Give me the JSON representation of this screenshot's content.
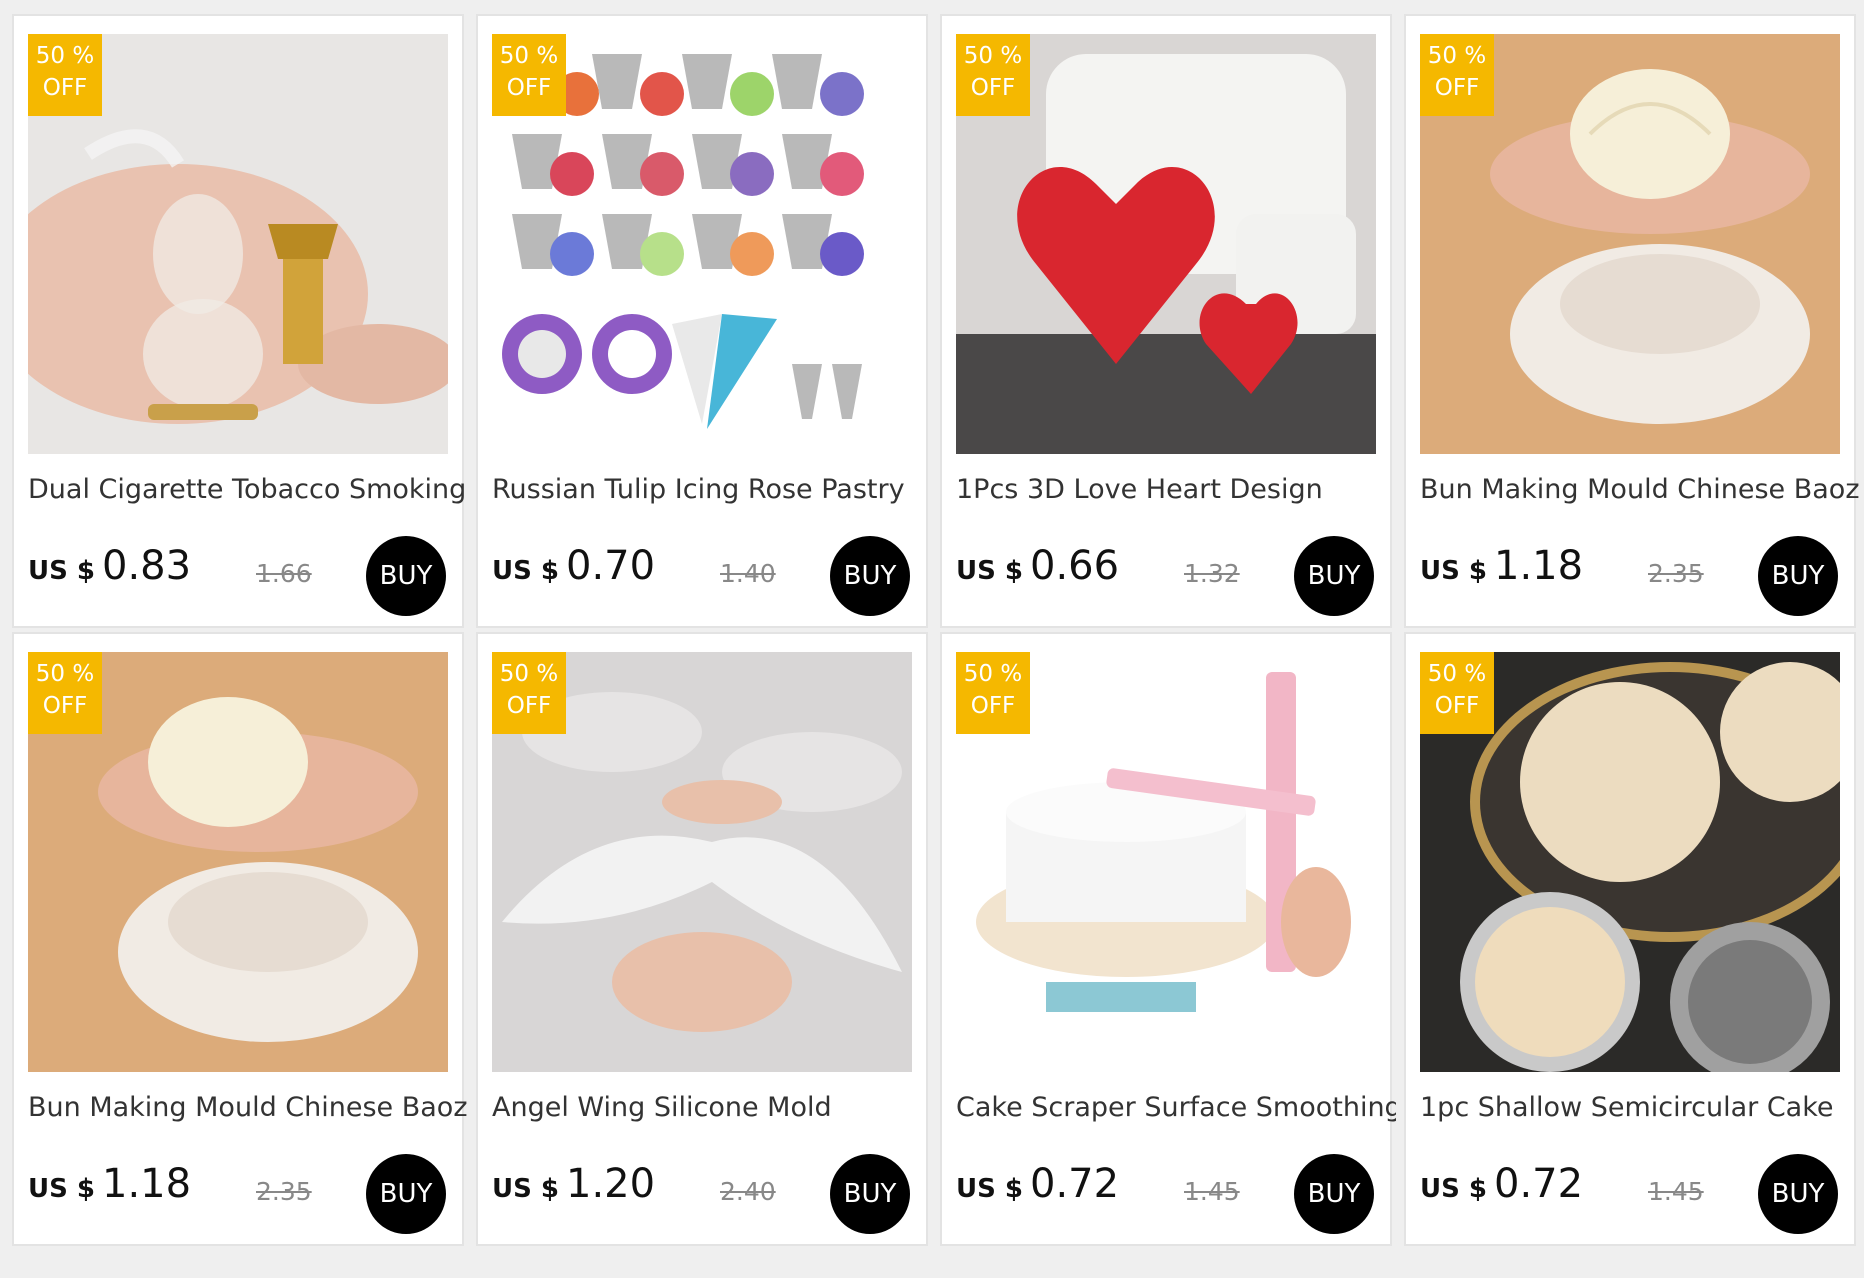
{
  "currency": "US $",
  "buy_label": "BUY",
  "badge": {
    "line1": "50 %",
    "line2": "OFF"
  },
  "products": [
    {
      "title": "Dual Cigarette Tobacco Smoking",
      "price": "0.83",
      "original_price": "1.66"
    },
    {
      "title": "Russian Tulip Icing Rose Pastry",
      "price": "0.70",
      "original_price": "1.40"
    },
    {
      "title": "1Pcs 3D Love Heart Design",
      "price": "0.66",
      "original_price": "1.32"
    },
    {
      "title": "Bun Making Mould Chinese Baozi",
      "price": "1.18",
      "original_price": "2.35"
    },
    {
      "title": "Bun Making Mould Chinese Baozi",
      "price": "1.18",
      "original_price": "2.35"
    },
    {
      "title": "Angel Wing Silicone Mold",
      "price": "1.20",
      "original_price": "2.40"
    },
    {
      "title": "Cake Scraper Surface Smoothing",
      "price": "0.72",
      "original_price": "1.45"
    },
    {
      "title": "1pc Shallow Semicircular Cake",
      "price": "0.72",
      "original_price": "1.45"
    }
  ]
}
